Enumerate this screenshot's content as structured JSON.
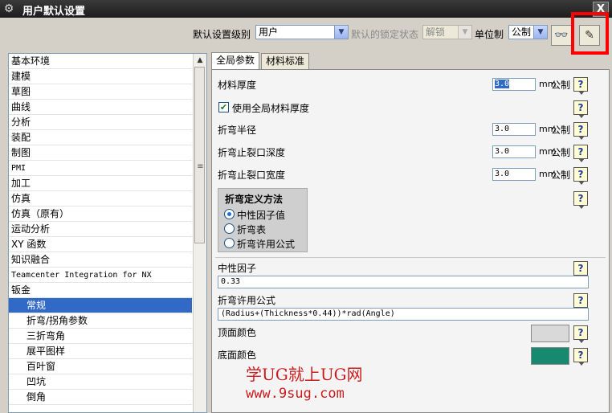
{
  "window": {
    "title": "用户默认设置",
    "close_label": "X"
  },
  "toolbar": {
    "level_label": "默认设置级别",
    "level_value": "用户",
    "lock_label": "默认的锁定状态",
    "lock_value": "解锁",
    "unit_label": "单位制",
    "unit_value": "公制",
    "btn1_icon": "glasses-icon",
    "btn2_icon": "manage-icon"
  },
  "tree": {
    "items": [
      {
        "label": "基本环境"
      },
      {
        "label": "建模"
      },
      {
        "label": "草图"
      },
      {
        "label": "曲线"
      },
      {
        "label": "分析"
      },
      {
        "label": "装配"
      },
      {
        "label": "制图"
      },
      {
        "label": "PMI"
      },
      {
        "label": "加工"
      },
      {
        "label": "仿真"
      },
      {
        "label": "仿真（原有）"
      },
      {
        "label": "运动分析"
      },
      {
        "label": "XY 函数"
      },
      {
        "label": "知识融合"
      },
      {
        "label": "Teamcenter Integration for NX"
      },
      {
        "label": "钣金"
      }
    ],
    "children": [
      {
        "label": "常规"
      },
      {
        "label": "折弯/拐角参数"
      },
      {
        "label": "三折弯角"
      },
      {
        "label": "展平图样"
      },
      {
        "label": "百叶窗"
      },
      {
        "label": "凹坑"
      },
      {
        "label": "倒角"
      }
    ]
  },
  "tabs": [
    {
      "label": "全局参数"
    },
    {
      "label": "材料标准"
    }
  ],
  "panel": {
    "thickness_label": "材料厚度",
    "thickness_value": "3.0",
    "unit_mm": "mm",
    "unit_metric": "公制",
    "use_global_label": "使用全局材料厚度",
    "bend_radius_label": "折弯半径",
    "bend_radius_value": "3.0",
    "relief_depth_label": "折弯止裂口深度",
    "relief_depth_value": "3.0",
    "relief_width_label": "折弯止裂口宽度",
    "relief_width_value": "3.0",
    "bend_method_title": "折弯定义方法",
    "radio_neutral": "中性因子值",
    "radio_table": "折弯表",
    "radio_formula": "折弯许用公式",
    "neutral_factor_label": "中性因子",
    "neutral_factor_value": "0.33",
    "formula_label": "折弯许用公式",
    "formula_value": "(Radius+(Thickness*0.44))*rad(Angle)",
    "top_color_label": "顶面颜色",
    "bottom_color_label": "底面颜色",
    "help_label": "?"
  },
  "colors": {
    "top_face": "#d9d9d9",
    "bottom_face": "#16896e",
    "highlight": "#ff0000"
  },
  "watermark": {
    "line1": "学UG就上UG网",
    "line2": "www.9sug.com"
  }
}
